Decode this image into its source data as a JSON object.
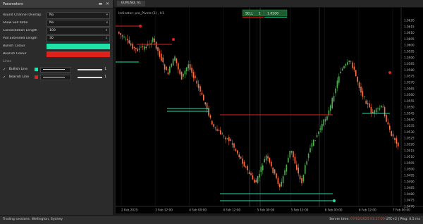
{
  "panel": {
    "title": "Parameters",
    "params": [
      {
        "label": "Round Channel Overlap",
        "value": "No"
      },
      {
        "label": "Show Sell Ratio",
        "value": "No"
      },
      {
        "label": "Consolidation Length",
        "value": "100"
      },
      {
        "label": "Pull Extended Length",
        "value": "30"
      }
    ],
    "colors": [
      {
        "label": "Bullish Colour",
        "hex": "#1fe2a8"
      },
      {
        "label": "Bearish Colour",
        "hex": "#e0221c"
      }
    ],
    "group_label": "Lines",
    "levels": [
      {
        "label": "Bullish Line",
        "color": "#1fe2a8",
        "width": "1"
      },
      {
        "label": "Bearish Line",
        "color": "#e0221c",
        "width": "1"
      }
    ]
  },
  "chart_tab": "EURUSD, h1",
  "chart": {
    "header": "Indicator: pro_Pivots (1) , h1",
    "buttons": {
      "sell": "SELL",
      "sell_qty": "1",
      "buy": "1.0500"
    },
    "colors": {
      "bull": "#1fe2a8",
      "bear": "#e0221c",
      "candle_up": "#4caf50",
      "candle_down": "#ff7043"
    },
    "price_labels": [
      "1.0620",
      "1.0615",
      "1.0610",
      "1.0605",
      "1.0600",
      "1.0595",
      "1.0590",
      "1.0585",
      "1.0580",
      "1.0575",
      "1.0570",
      "1.0565",
      "1.0560",
      "1.0555",
      "1.0550",
      "1.0545",
      "1.0540",
      "1.0535",
      "1.0530",
      "1.0525",
      "1.0520",
      "1.0515",
      "1.0510",
      "1.0505",
      "1.0500",
      "1.0495",
      "1.0490",
      "1.0485",
      "1.0480",
      "1.0475",
      "1.0470"
    ],
    "time_labels": [
      "2 Feb 2025",
      "3 Feb 12:00",
      "4 Feb 00:00",
      "4 Feb 12:00",
      "5 Feb 00:00",
      "5 Feb 12:00",
      "6 Feb 00:00",
      "6 Feb 12:00",
      "7 Feb 00:00"
    ]
  },
  "status": {
    "left": "Trading sessions: Wellington, Sydney",
    "server_label": "Server time:",
    "server_time": "07/02/2025 01:27:00",
    "utc": "UTC+2",
    "right": "Ping: 0.5 ms"
  }
}
